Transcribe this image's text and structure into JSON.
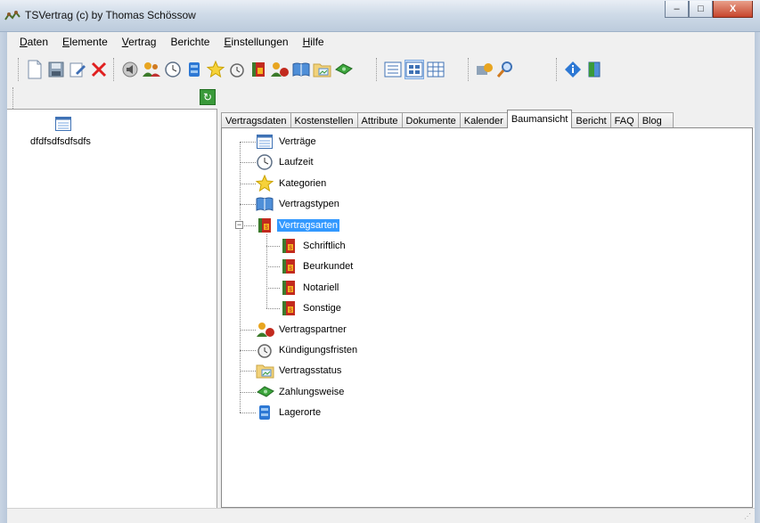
{
  "window": {
    "title": "TSVertrag (c) by Thomas Schössow",
    "minimize_glyph": "–",
    "maximize_glyph": "□",
    "close_glyph": "X"
  },
  "menu": {
    "items": [
      {
        "label": "Daten"
      },
      {
        "label": "Elemente"
      },
      {
        "label": "Vertrag"
      },
      {
        "label": "Berichte"
      },
      {
        "label": "Einstellungen"
      },
      {
        "label": "Hilfe"
      }
    ]
  },
  "toolbar": {
    "icons": [
      "new-document-icon",
      "save-icon",
      "edit-icon",
      "delete-icon",
      "speaker-icon",
      "people-icon",
      "clock-icon",
      "storage-icon",
      "star-icon",
      "alarm-clock-icon",
      "book-red-icon",
      "partner-icon",
      "open-book-icon",
      "folder-image-icon",
      "money-icon",
      "list-view-icon",
      "detail-view-icon",
      "grid-view-icon",
      "tools-icon",
      "search-icon",
      "info-icon",
      "exit-icon"
    ]
  },
  "refresh_glyph": "↻",
  "left_panel": {
    "contract_label": "dfdfsdfsdfsdfs"
  },
  "tabs": [
    {
      "label": "Vertragsdaten"
    },
    {
      "label": "Kostenstellen"
    },
    {
      "label": "Attribute"
    },
    {
      "label": "Dokumente"
    },
    {
      "label": "Kalender"
    },
    {
      "label": "Baumansicht",
      "active": true
    },
    {
      "label": "Bericht"
    },
    {
      "label": "FAQ"
    },
    {
      "label": "Blog"
    }
  ],
  "tree": {
    "expander_glyph": "−",
    "nodes": [
      {
        "label": "Verträge",
        "icon": "document-list-icon"
      },
      {
        "label": "Laufzeit",
        "icon": "clock-icon"
      },
      {
        "label": "Kategorien",
        "icon": "star-icon"
      },
      {
        "label": "Vertragstypen",
        "icon": "book-icon"
      },
      {
        "label": "Vertragsarten",
        "icon": "red-book-icon",
        "selected": true,
        "expanded": true
      },
      {
        "label": "Schriftlich",
        "icon": "red-book-icon",
        "child": true
      },
      {
        "label": "Beurkundet",
        "icon": "red-book-icon",
        "child": true
      },
      {
        "label": "Notariell",
        "icon": "red-book-icon",
        "child": true
      },
      {
        "label": "Sonstige",
        "icon": "red-book-icon",
        "child": true
      },
      {
        "label": "Vertragspartner",
        "icon": "partner-icon"
      },
      {
        "label": "Kündigungsfristen",
        "icon": "alarm-clock-icon"
      },
      {
        "label": "Vertragsstatus",
        "icon": "folder-image-icon"
      },
      {
        "label": "Zahlungsweise",
        "icon": "money-icon"
      },
      {
        "label": "Lagerorte",
        "icon": "storage-icon"
      }
    ]
  }
}
